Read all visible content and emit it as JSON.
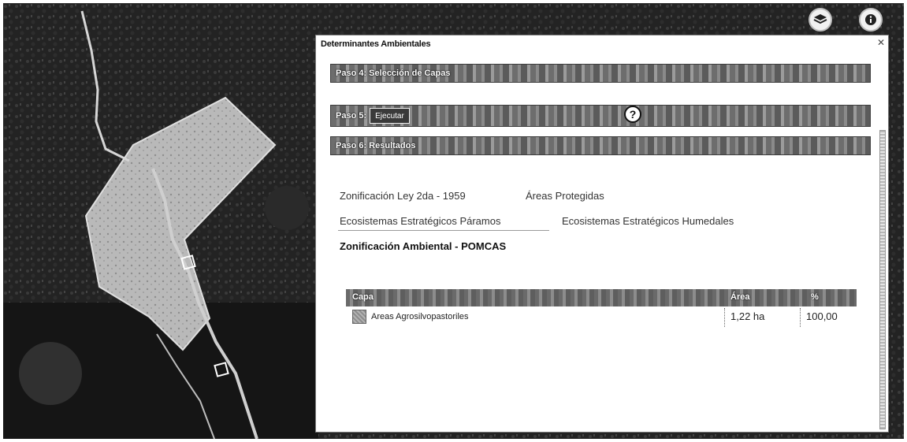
{
  "toolbar": {
    "layers_icon": "layers-icon",
    "info_icon": "info-icon"
  },
  "panel": {
    "title": "Determinantes Ambientales",
    "step4_label": "Paso 4: Selección de Capas",
    "step5_label": "Paso 5:",
    "execute_label": "Ejecutar",
    "help_symbol": "?",
    "step6_label": "Paso 6: Resultados"
  },
  "tabs": [
    {
      "label": "Zonificación Ley 2da - 1959",
      "active": false
    },
    {
      "label": "Áreas Protegidas",
      "active": false
    },
    {
      "label": "Ecosistemas Estratégicos Páramos",
      "active": false
    },
    {
      "label": "Ecosistemas Estratégicos Humedales",
      "active": false
    },
    {
      "label": "Zonificación Ambiental - POMCAS",
      "active": true
    }
  ],
  "results_table": {
    "headers": [
      "Capa",
      "Área",
      "%"
    ],
    "rows": [
      {
        "capa": "Areas Agrosilvopastoriles",
        "area": "1,22 ha",
        "percent": "100,00"
      }
    ]
  },
  "colors": {
    "map_background": "#1c1c1c",
    "polygon_fill": "#c4c4c4",
    "bar_dark": "#5b5b5b"
  }
}
